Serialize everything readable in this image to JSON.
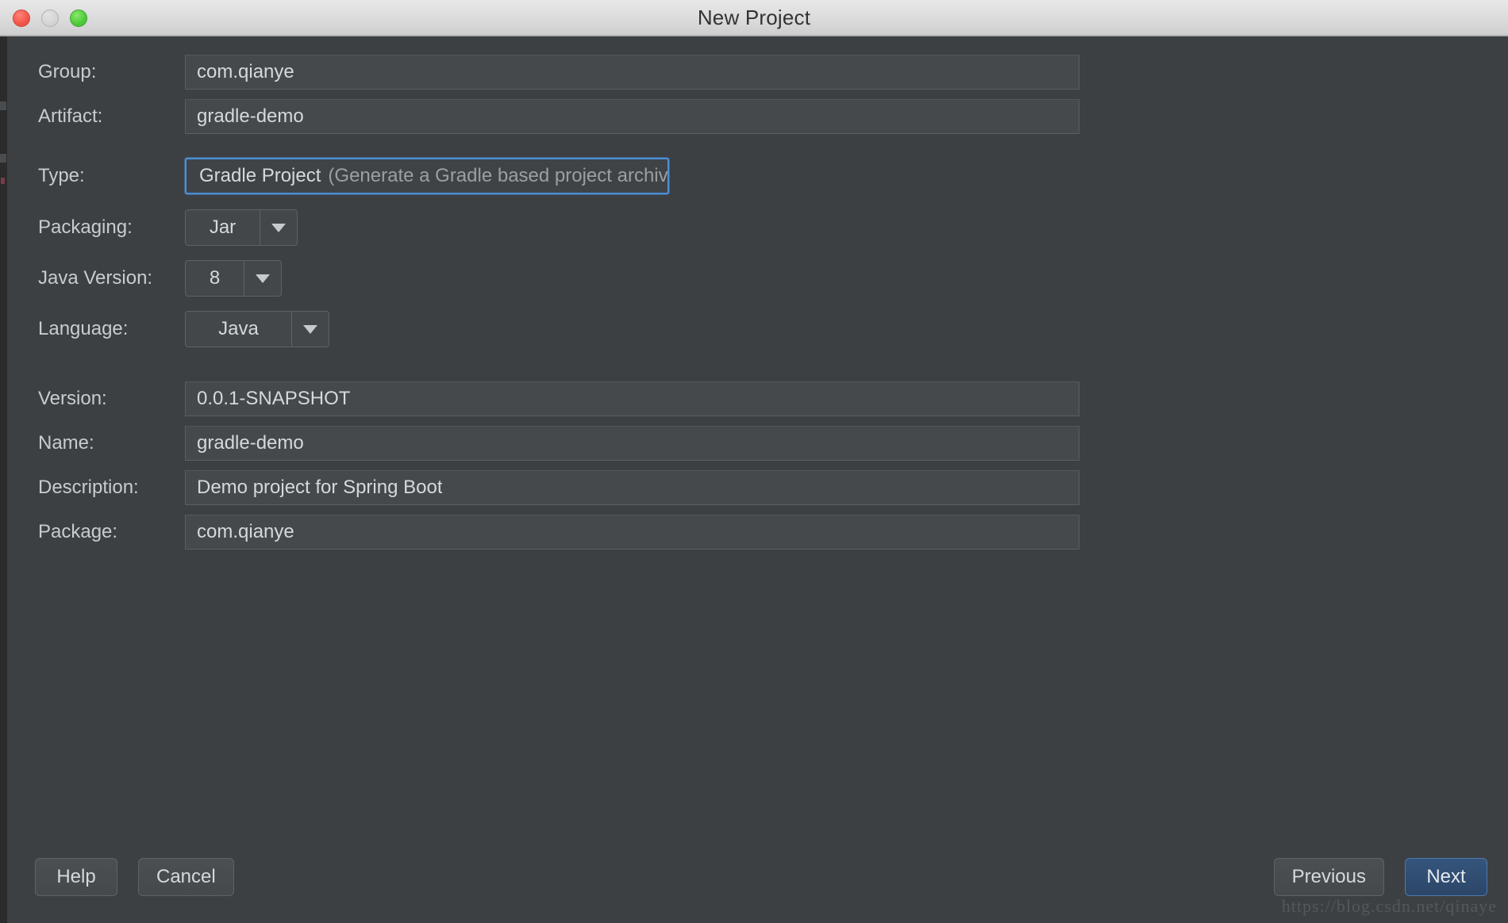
{
  "titlebar": {
    "title": "New Project",
    "controls": [
      {
        "name": "close",
        "label": "close-button"
      },
      {
        "name": "minimize",
        "label": "minimize-button"
      },
      {
        "name": "zoom",
        "label": "zoom-button"
      }
    ]
  },
  "form": {
    "group": {
      "label": "Group:",
      "value": "com.qianye"
    },
    "artifact": {
      "label": "Artifact:",
      "value": "gradle-demo"
    },
    "type": {
      "label": "Type:",
      "value": "Gradle Project",
      "hint": "(Generate a Gradle based project archive)",
      "focused": true
    },
    "packaging": {
      "label": "Packaging:",
      "value": "Jar"
    },
    "java_version": {
      "label": "Java Version:",
      "value": "8"
    },
    "language": {
      "label": "Language:",
      "value": "Java"
    },
    "version": {
      "label": "Version:",
      "value": "0.0.1-SNAPSHOT"
    },
    "name": {
      "label": "Name:",
      "value": "gradle-demo"
    },
    "description": {
      "label": "Description:",
      "value": "Demo project for Spring Boot"
    },
    "package": {
      "label": "Package:",
      "value": "com.qianye"
    }
  },
  "footer": {
    "help_label": "Help",
    "cancel_label": "Cancel",
    "previous_label": "Previous",
    "next_label": "Next"
  },
  "watermark": "https://blog.csdn.net/qinaye",
  "colors": {
    "dialog_background": "#3c4043",
    "field_background": "#45494c",
    "field_border": "#5a5f63",
    "text": "#d6d9db",
    "muted_text": "#9b9fa2",
    "focus_blue": "#4a90d9",
    "primary_button": "#2c4668",
    "titlebar": "#dcdcdc"
  }
}
